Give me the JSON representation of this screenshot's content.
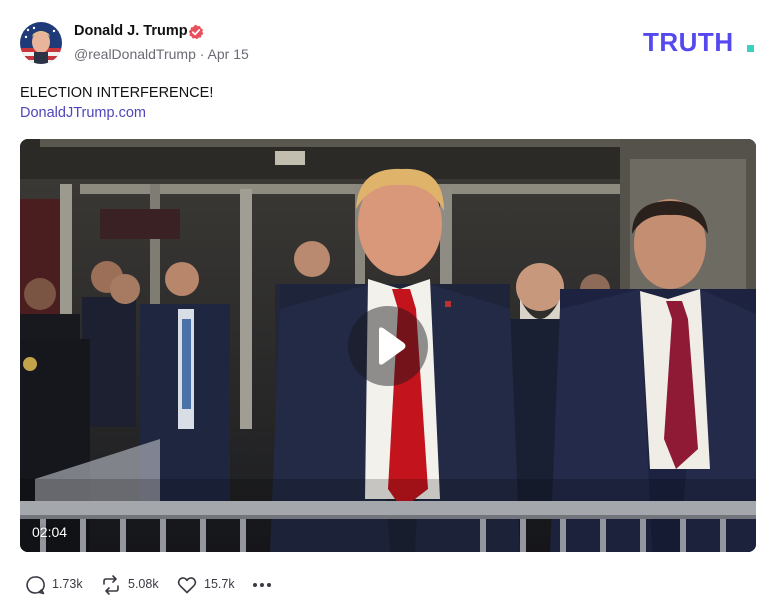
{
  "author": {
    "name": "Donald J. Trump",
    "handle": "@realDonaldTrump",
    "date": "Apr 15",
    "separator": " · "
  },
  "brand": {
    "logo_text": "TRUTH",
    "accent": "#5448ee",
    "dot_color": "#3ad1c0"
  },
  "post": {
    "text": "ELECTION INTERFERENCE!",
    "link": "DonaldJTrump.com"
  },
  "video": {
    "duration": "02:04"
  },
  "actions": {
    "replies": "1.73k",
    "retruths": "5.08k",
    "likes": "15.7k"
  },
  "colors": {
    "verified": "#e8505b",
    "link": "#4f46b8",
    "muted": "#6b6b75"
  }
}
